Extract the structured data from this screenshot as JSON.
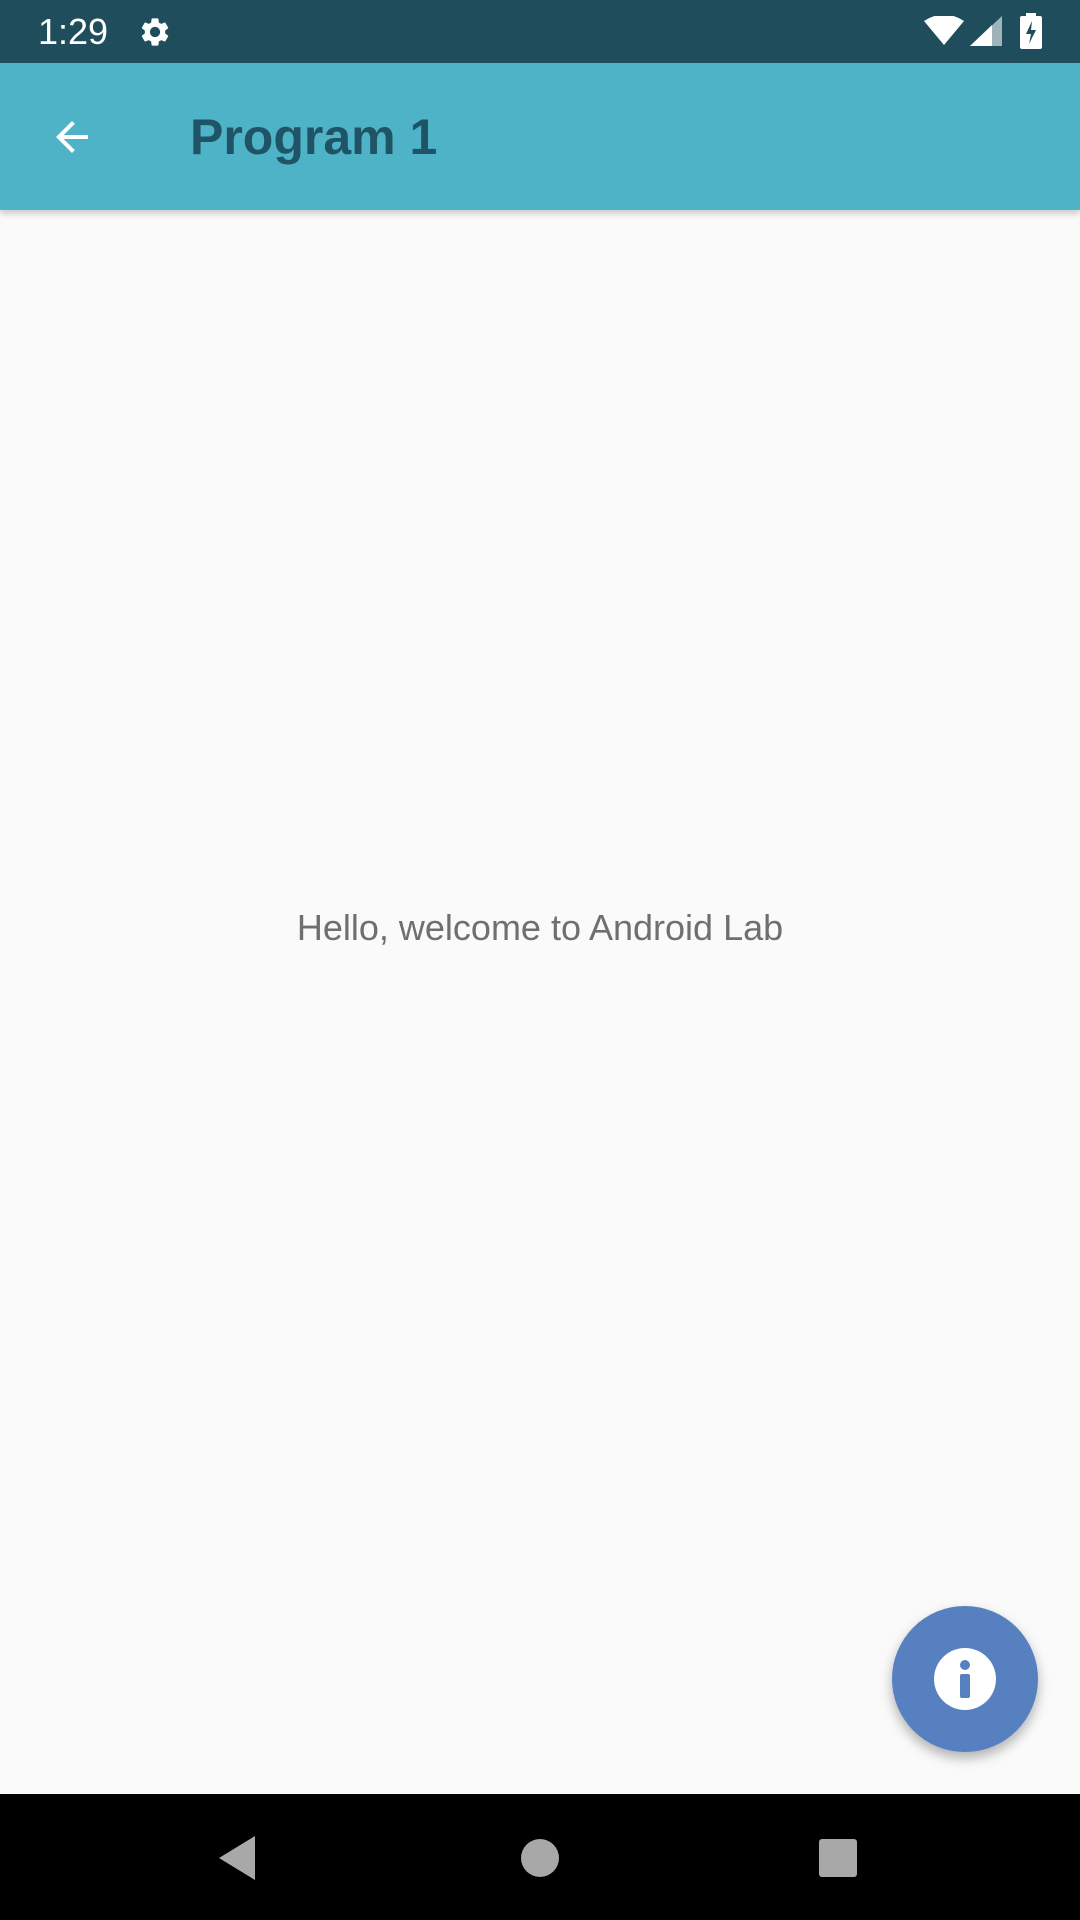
{
  "status_bar": {
    "time": "1:29",
    "icons": [
      "gear-icon",
      "wifi-icon",
      "signal-icon",
      "battery-charging-icon"
    ]
  },
  "app_bar": {
    "title": "Program 1",
    "back_icon": "arrow-back-icon",
    "color": "#4fb3c7"
  },
  "content": {
    "message": "Hello, welcome to Android Lab"
  },
  "fab": {
    "icon": "info-icon",
    "color": "#5680c0"
  },
  "nav_bar": {
    "icons": [
      "nav-back-icon",
      "nav-home-icon",
      "nav-recents-icon"
    ]
  }
}
